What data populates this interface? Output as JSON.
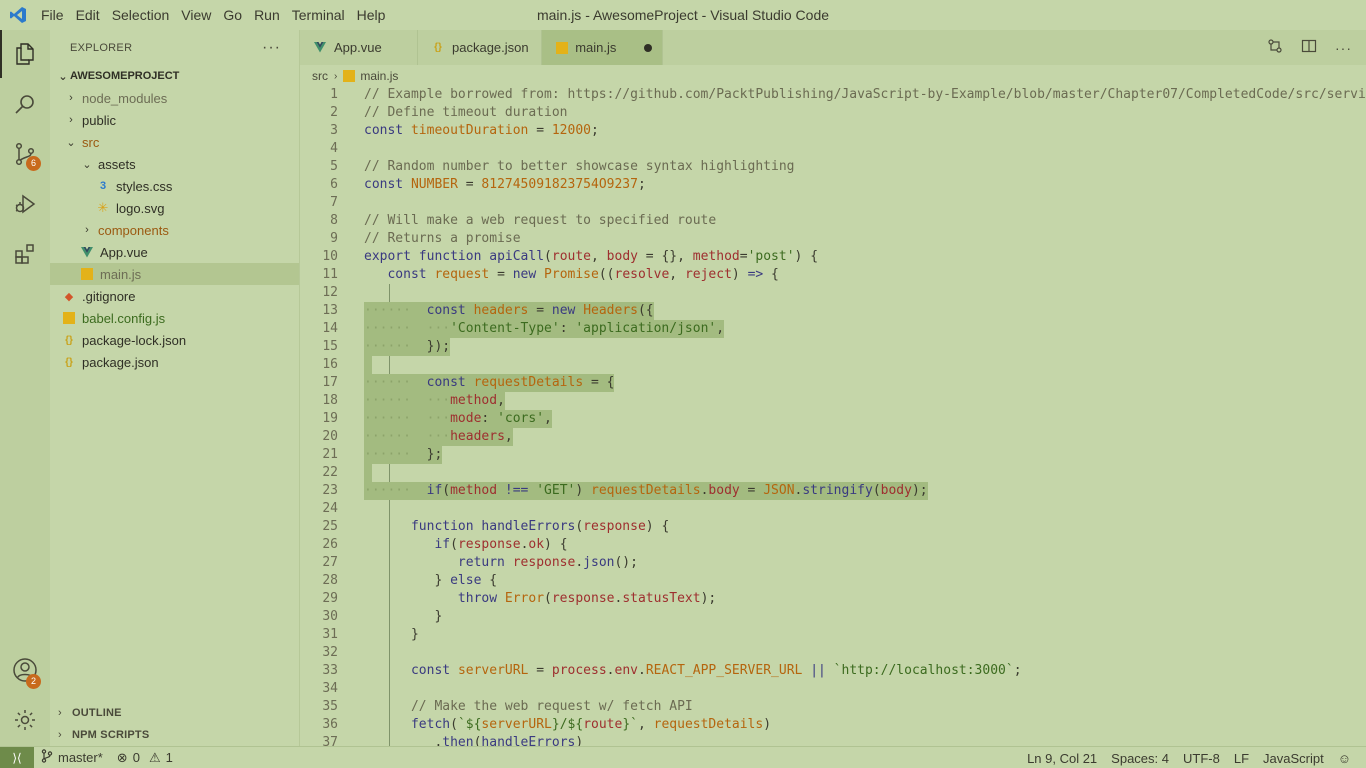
{
  "window": {
    "title": "main.js - AwesomeProject - Visual Studio Code"
  },
  "menu": [
    "File",
    "Edit",
    "Selection",
    "View",
    "Go",
    "Run",
    "Terminal",
    "Help"
  ],
  "activity": {
    "scm_badge": "6",
    "accounts_badge": "2"
  },
  "sidebar": {
    "header": "EXPLORER",
    "more": "···",
    "project": "AWESOMEPROJECT",
    "items": [
      {
        "label": "node_modules"
      },
      {
        "label": "public"
      },
      {
        "label": "src"
      },
      {
        "label": "assets"
      },
      {
        "label": "styles.css"
      },
      {
        "label": "logo.svg"
      },
      {
        "label": "components"
      },
      {
        "label": "App.vue"
      },
      {
        "label": "main.js"
      },
      {
        "label": ".gitignore"
      },
      {
        "label": "babel.config.js"
      },
      {
        "label": "package-lock.json"
      },
      {
        "label": "package.json"
      }
    ],
    "outline": "OUTLINE",
    "npm": "NPM SCRIPTS"
  },
  "tabs": [
    {
      "label": "App.vue"
    },
    {
      "label": "package.json"
    },
    {
      "label": "main.js"
    }
  ],
  "breadcrumb": {
    "folder": "src",
    "file": "main.js"
  },
  "editor": {
    "lines": [
      "1",
      "2",
      "3",
      "4",
      "5",
      "6",
      "7",
      "8",
      "9",
      "10",
      "11",
      "12",
      "13",
      "14",
      "15",
      "16",
      "17",
      "18",
      "19",
      "20",
      "21",
      "22",
      "23",
      "24",
      "25",
      "26",
      "27",
      "28",
      "29",
      "30",
      "31",
      "32",
      "33",
      "34",
      "35",
      "36",
      "37"
    ]
  },
  "status": {
    "branch": "master*",
    "errors": "0",
    "warnings": "1",
    "position": "Ln 9, Col 21",
    "spaces": "Spaces: 4",
    "encoding": "UTF-8",
    "eol": "LF",
    "language": "JavaScript"
  },
  "colors": {
    "background": "#c5d6a9",
    "accent": "#6e8b4a",
    "badge": "#c86a1c"
  }
}
